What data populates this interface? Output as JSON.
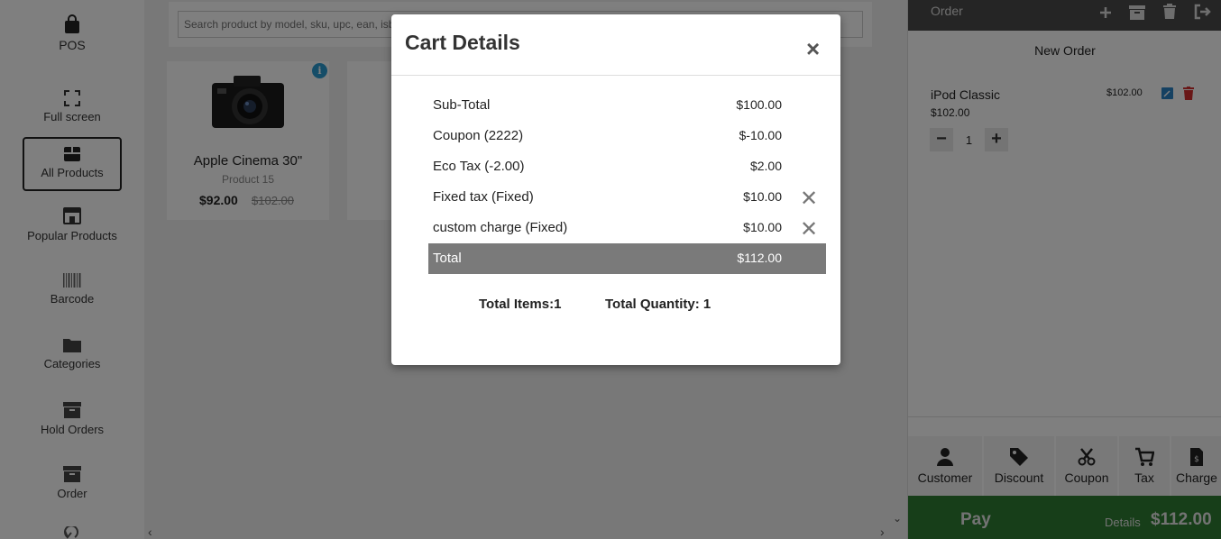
{
  "sidebar": {
    "items": [
      {
        "label": "POS",
        "icon": "bag-icon"
      },
      {
        "label": "Full screen",
        "icon": "fullscreen-icon"
      },
      {
        "label": "All Products",
        "icon": "box-icon"
      },
      {
        "label": "Popular Products",
        "icon": "store-icon"
      },
      {
        "label": "Barcode",
        "icon": "barcode-icon"
      },
      {
        "label": "Categories",
        "icon": "folder-icon"
      },
      {
        "label": "Hold Orders",
        "icon": "archive-icon"
      },
      {
        "label": "Order",
        "icon": "archive-icon"
      }
    ]
  },
  "search": {
    "placeholder": "Search product by model, sku, upc, ean, isbn"
  },
  "products": [
    {
      "name": "Apple Cinema 30\"",
      "model": "Product 15",
      "price": "$92.00",
      "old_price": "$102.00",
      "info": "i"
    }
  ],
  "order_panel": {
    "title": "Order",
    "subtitle": "New Order",
    "items": [
      {
        "name": "iPod Classic",
        "unit_price": "$102.00",
        "line_total": "$102.00",
        "qty": "1"
      }
    ],
    "actions": [
      {
        "label": "Customer",
        "icon": "user-icon"
      },
      {
        "label": "Discount",
        "icon": "tag-icon"
      },
      {
        "label": "Coupon",
        "icon": "scissors-icon"
      },
      {
        "label": "Tax",
        "icon": "cart-icon"
      },
      {
        "label": "Charge",
        "icon": "invoice-icon"
      }
    ],
    "pay": {
      "label": "Pay",
      "details": "Details",
      "amount": "$112.00"
    }
  },
  "modal": {
    "title": "Cart Details",
    "close": "×",
    "rows": [
      {
        "label": "Sub-Total",
        "value": "$100.00",
        "removable": false
      },
      {
        "label": "Coupon (2222)",
        "value": "$-10.00",
        "removable": false
      },
      {
        "label": "Eco Tax (-2.00)",
        "value": "$2.00",
        "removable": false
      },
      {
        "label": "Fixed tax (Fixed)",
        "value": "$10.00",
        "removable": true
      },
      {
        "label": "custom charge (Fixed)",
        "value": "$10.00",
        "removable": true
      }
    ],
    "total": {
      "label": "Total",
      "value": "$112.00"
    },
    "remove_glyph": "✕",
    "total_items": "Total Items:1",
    "total_quantity": "Total Quantity: 1"
  },
  "colors": {
    "accent_blue": "#2a9bd0",
    "pay_green": "#2e7d32",
    "delete_red": "#d32f2f",
    "header_dark": "#4a4a4a",
    "total_row": "#7a7a7a"
  }
}
